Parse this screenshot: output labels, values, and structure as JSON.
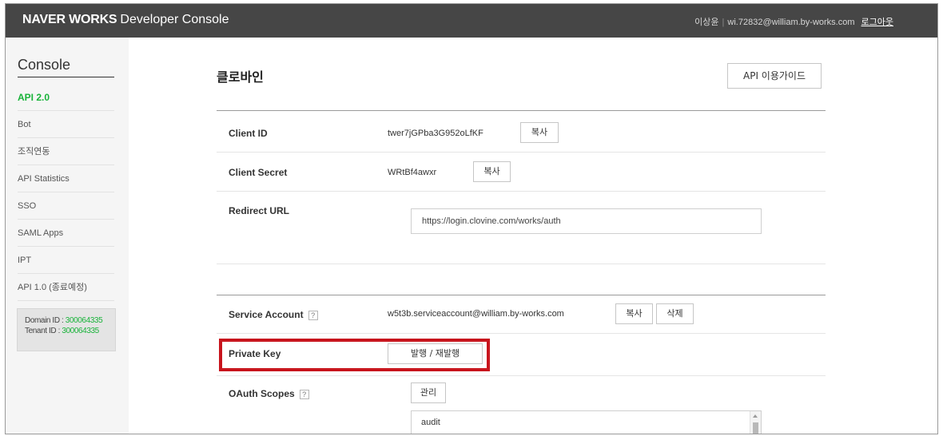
{
  "header": {
    "brand_bold": "NAVER WORKS",
    "brand_light": "Developer Console",
    "user_name": "이상윤",
    "user_email": "wi.72832@william.by-works.com",
    "logout_label": "로그아웃"
  },
  "sidebar": {
    "title": "Console",
    "items": [
      {
        "label": "API 2.0",
        "active": true
      },
      {
        "label": "Bot",
        "active": false
      },
      {
        "label": "조직연동",
        "active": false
      },
      {
        "label": "API Statistics",
        "active": false
      },
      {
        "label": "SSO",
        "active": false
      },
      {
        "label": "SAML Apps",
        "active": false
      },
      {
        "label": "IPT",
        "active": false
      },
      {
        "label": "API 1.0 (종료예정)",
        "active": false
      }
    ],
    "domain_label": "Domain ID : ",
    "domain_value": "300064335",
    "tenant_label": "Tenant ID : ",
    "tenant_value": "300064335"
  },
  "main": {
    "title": "클로바인",
    "guide_button": "API 이용가이드",
    "client_id": {
      "label": "Client ID",
      "value": "twer7jGPba3G952oLfKF",
      "copy": "복사"
    },
    "client_secret": {
      "label": "Client Secret",
      "value": "WRtBf4awxr",
      "copy": "복사"
    },
    "redirect_url": {
      "label": "Redirect URL",
      "value": "https://login.clovine.com/works/auth"
    },
    "service_account": {
      "label": "Service Account",
      "help": "?",
      "value": "w5t3b.serviceaccount@william.by-works.com",
      "copy": "복사",
      "delete": "삭제"
    },
    "private_key": {
      "label": "Private Key",
      "issue_button": "발행 / 재발행"
    },
    "oauth_scopes": {
      "label": "OAuth Scopes",
      "help": "?",
      "manage_button": "관리",
      "items": [
        "audit"
      ]
    }
  },
  "colors": {
    "topbar": "#464646",
    "accent_green": "#19b33a",
    "highlight_red": "#c8151d"
  }
}
